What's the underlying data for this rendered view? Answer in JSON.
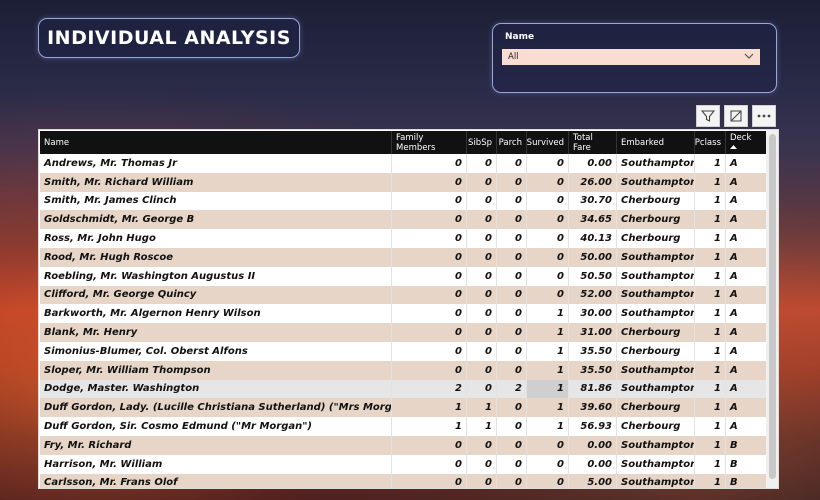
{
  "title": "INDIVIDUAL ANALYSIS",
  "slicer": {
    "label": "Name",
    "value": "All"
  },
  "toolbar": {
    "filter_icon": "filter-icon",
    "focus_icon": "focus-mode-icon",
    "more_icon": "more-options-icon"
  },
  "table": {
    "headers": [
      "Name",
      "Family Members",
      "SibSp",
      "Parch",
      "Survived",
      "Total Fare",
      "Embarked",
      "Pclass",
      "Deck"
    ],
    "sort_column": "Deck",
    "sort_direction": "ascending",
    "rows": [
      [
        "Andrews, Mr. Thomas Jr",
        "0",
        "0",
        "0",
        "0",
        "0.00",
        "Southampton",
        "1",
        "A"
      ],
      [
        "Smith, Mr. Richard William",
        "0",
        "0",
        "0",
        "0",
        "26.00",
        "Southampton",
        "1",
        "A"
      ],
      [
        "Smith, Mr. James Clinch",
        "0",
        "0",
        "0",
        "0",
        "30.70",
        "Cherbourg",
        "1",
        "A"
      ],
      [
        "Goldschmidt, Mr. George B",
        "0",
        "0",
        "0",
        "0",
        "34.65",
        "Cherbourg",
        "1",
        "A"
      ],
      [
        "Ross, Mr. John Hugo",
        "0",
        "0",
        "0",
        "0",
        "40.13",
        "Cherbourg",
        "1",
        "A"
      ],
      [
        "Rood, Mr. Hugh Roscoe",
        "0",
        "0",
        "0",
        "0",
        "50.00",
        "Southampton",
        "1",
        "A"
      ],
      [
        "Roebling, Mr. Washington Augustus II",
        "0",
        "0",
        "0",
        "0",
        "50.50",
        "Southampton",
        "1",
        "A"
      ],
      [
        "Clifford, Mr. George Quincy",
        "0",
        "0",
        "0",
        "0",
        "52.00",
        "Southampton",
        "1",
        "A"
      ],
      [
        "Barkworth, Mr. Algernon Henry Wilson",
        "0",
        "0",
        "0",
        "1",
        "30.00",
        "Southampton",
        "1",
        "A"
      ],
      [
        "Blank, Mr. Henry",
        "0",
        "0",
        "0",
        "1",
        "31.00",
        "Cherbourg",
        "1",
        "A"
      ],
      [
        "Simonius-Blumer, Col. Oberst Alfons",
        "0",
        "0",
        "0",
        "1",
        "35.50",
        "Cherbourg",
        "1",
        "A"
      ],
      [
        "Sloper, Mr. William Thompson",
        "0",
        "0",
        "0",
        "1",
        "35.50",
        "Southampton",
        "1",
        "A"
      ],
      [
        "Dodge, Master. Washington",
        "2",
        "0",
        "2",
        "1",
        "81.86",
        "Southampton",
        "1",
        "A"
      ],
      [
        "Duff Gordon, Lady. (Lucille Christiana Sutherland) (\"Mrs Morgan\")",
        "1",
        "1",
        "0",
        "1",
        "39.60",
        "Cherbourg",
        "1",
        "A"
      ],
      [
        "Duff Gordon, Sir. Cosmo Edmund (\"Mr Morgan\")",
        "1",
        "1",
        "0",
        "1",
        "56.93",
        "Cherbourg",
        "1",
        "A"
      ],
      [
        "Fry, Mr. Richard",
        "0",
        "0",
        "0",
        "0",
        "0.00",
        "Southampton",
        "1",
        "B"
      ],
      [
        "Harrison, Mr. William",
        "0",
        "0",
        "0",
        "0",
        "0.00",
        "Southampton",
        "1",
        "B"
      ],
      [
        "Carlsson, Mr. Frans Olof",
        "0",
        "0",
        "0",
        "0",
        "5.00",
        "Southampton",
        "1",
        "B"
      ]
    ],
    "selected_row": 12
  },
  "colors": {
    "header_bg": "#111111",
    "band_row": "#e7d6c8",
    "title_border": "#9aa6d8",
    "slicer_field": "#f8ddd0"
  }
}
